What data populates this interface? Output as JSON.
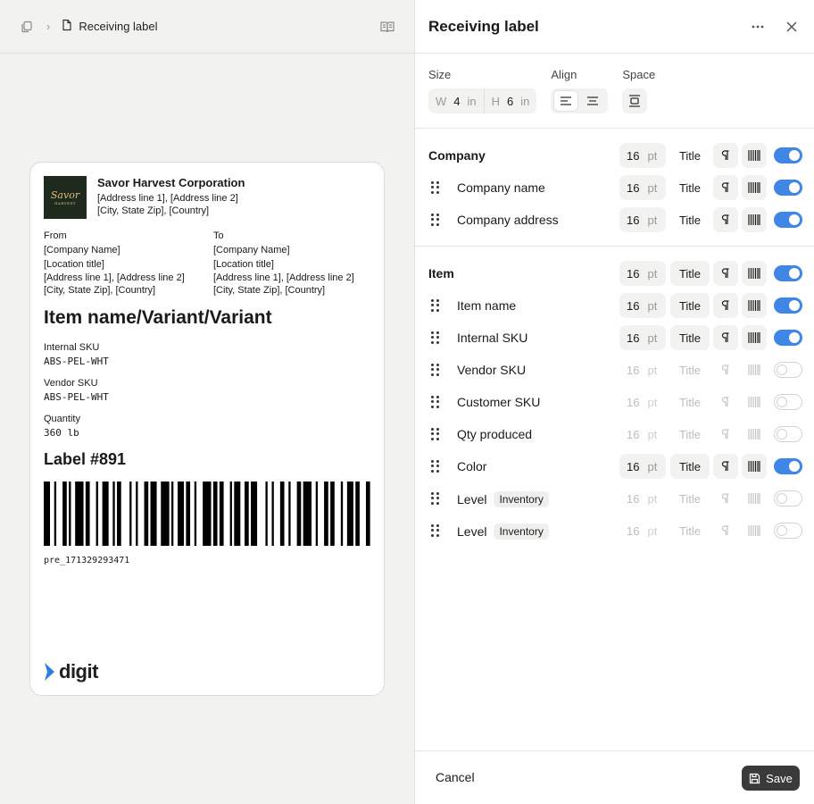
{
  "breadcrumb": {
    "current": "Receiving label"
  },
  "label": {
    "logo_text": "Savor",
    "logo_sub": "HARVEST",
    "company_name": "Savor Harvest Corporation",
    "company_address_line1": "[Address line 1], [Address line 2]",
    "company_address_line2": "[City, State Zip], [Country]",
    "from": {
      "heading": "From",
      "company": "[Company Name]",
      "location": "[Location title]",
      "addr1": "[Address line 1], [Address line 2]",
      "addr2": "[City, State Zip], [Country]"
    },
    "to": {
      "heading": "To",
      "company": "[Company Name]",
      "location": "[Location title]",
      "addr1": "[Address line 1], [Address line 2]",
      "addr2": "[City, State Zip], [Country]"
    },
    "item_name": "Item name/Variant/Variant",
    "internal_sku_label": "Internal SKU",
    "internal_sku_value": "ABS-PEL-WHT",
    "vendor_sku_label": "Vendor SKU",
    "vendor_sku_value": "ABS-PEL-WHT",
    "quantity_label": "Quantity",
    "quantity_value": "360 lb",
    "label_number": "Label #891",
    "barcode_text": "pre_171329293471",
    "brand": "digit"
  },
  "panel": {
    "title": "Receiving label",
    "size_label": "Size",
    "width_prefix": "W",
    "width_value": "4",
    "height_prefix": "H",
    "height_value": "6",
    "unit_in": "in",
    "align_label": "Align",
    "space_label": "Space",
    "unit_pt": "pt",
    "title_text": "Title",
    "company_section": "Company",
    "item_section": "Item",
    "company_rows": [
      {
        "name": "Company name",
        "size": "16",
        "enabled": true
      },
      {
        "name": "Company address",
        "size": "16",
        "enabled": true
      }
    ],
    "item_rows": [
      {
        "name": "Item name",
        "size": "16",
        "enabled": true
      },
      {
        "name": "Internal SKU",
        "size": "16",
        "enabled": true
      },
      {
        "name": "Vendor SKU",
        "size": "16",
        "enabled": false
      },
      {
        "name": "Customer SKU",
        "size": "16",
        "enabled": false
      },
      {
        "name": "Qty produced",
        "size": "16",
        "enabled": false
      },
      {
        "name": "Color",
        "size": "16",
        "enabled": true
      },
      {
        "name": "Level",
        "badge": "Inventory",
        "size": "16",
        "enabled": false
      },
      {
        "name": "Level",
        "badge": "Inventory",
        "size": "16",
        "enabled": false
      }
    ],
    "company_section_size": "16",
    "item_section_size": "16",
    "cancel_label": "Cancel",
    "save_label": "Save",
    "accent_color": "#3f86e6"
  }
}
